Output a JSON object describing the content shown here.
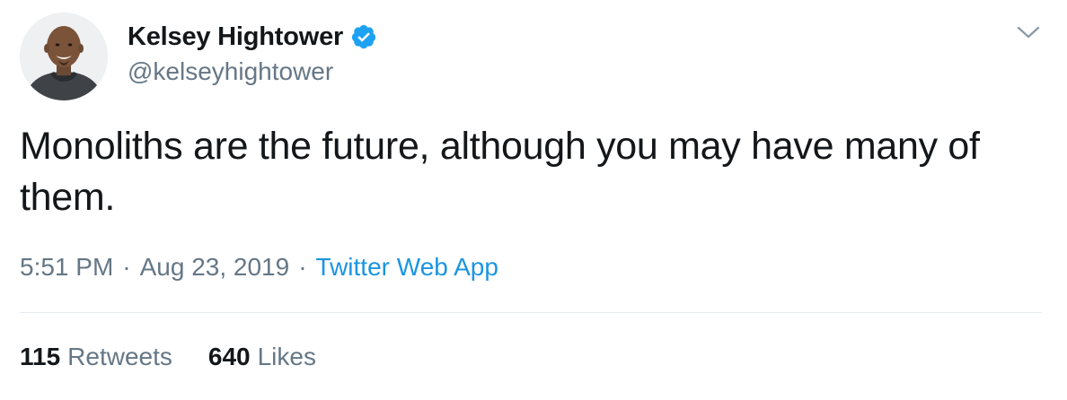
{
  "author": {
    "display_name": "Kelsey Hightower",
    "handle": "@kelseyhightower",
    "verified_icon": "verified-badge-icon",
    "avatar": "profile-photo"
  },
  "menu_icon": "chevron-down-icon",
  "tweet": {
    "text": "Monoliths are the future, although you may have many of them.",
    "time": "5:51 PM",
    "separator_1": "·",
    "date": "Aug 23, 2019",
    "separator_2": "·",
    "source": "Twitter Web App"
  },
  "stats": {
    "retweets_count": "115",
    "retweets_label": "Retweets",
    "likes_count": "640",
    "likes_label": "Likes"
  },
  "colors": {
    "text_primary": "#14171a",
    "text_secondary": "#657786",
    "link": "#1b95e0",
    "verified": "#1da1f2",
    "divider": "#e6ecf0"
  }
}
